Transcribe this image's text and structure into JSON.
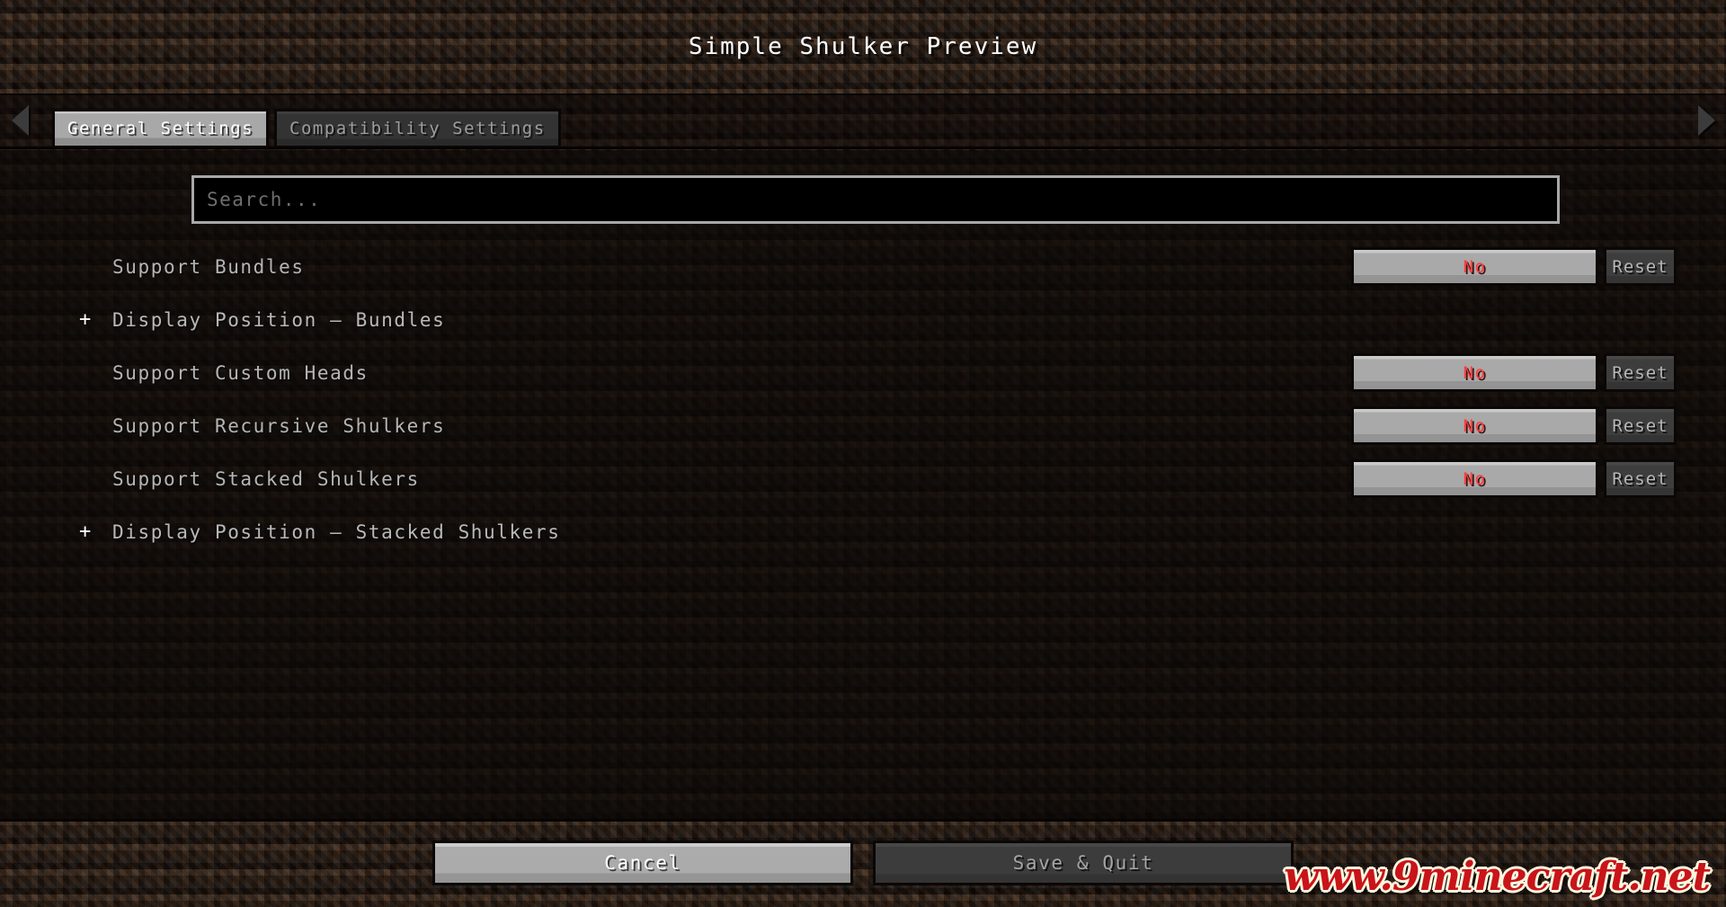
{
  "window": {
    "title": "Simple Shulker Preview"
  },
  "nav": {
    "left_arrow_icon": "triangle-left-icon",
    "right_arrow_icon": "triangle-right-icon"
  },
  "tabs": [
    {
      "label": "General Settings",
      "active": true
    },
    {
      "label": "Compatibility Settings",
      "active": false
    }
  ],
  "search": {
    "placeholder": "Search...",
    "value": ""
  },
  "options": [
    {
      "type": "toggle",
      "label": "Support Bundles",
      "value": "No",
      "reset_label": "Reset"
    },
    {
      "type": "category",
      "expander": "+",
      "label": "Display Position — Bundles"
    },
    {
      "type": "toggle",
      "label": "Support Custom Heads",
      "value": "No",
      "reset_label": "Reset"
    },
    {
      "type": "toggle",
      "label": "Support Recursive Shulkers",
      "value": "No",
      "reset_label": "Reset"
    },
    {
      "type": "toggle",
      "label": "Support Stacked Shulkers",
      "value": "No",
      "reset_label": "Reset"
    },
    {
      "type": "category",
      "expander": "+",
      "label": "Display Position — Stacked Shulkers"
    }
  ],
  "footer": {
    "cancel_label": "Cancel",
    "save_label": "Save & Quit"
  },
  "watermark": {
    "text": "www.9minecraft.net"
  },
  "colors": {
    "background": "#2b1d14",
    "panel": "#0a0705",
    "value_text": "#ff3d3d",
    "label_text": "#b5b5b5",
    "active_tab": "#a8a8a8",
    "watermark": "#c9141a"
  }
}
